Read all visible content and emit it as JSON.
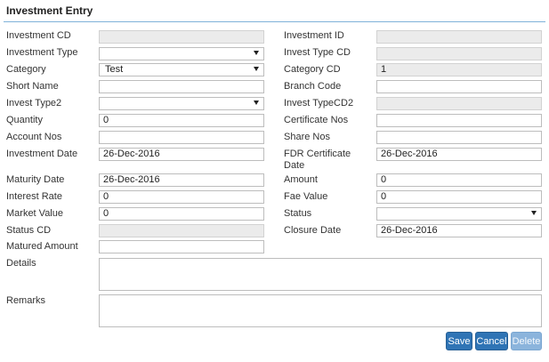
{
  "page_title": "Investment Entry",
  "left": {
    "investment_cd": {
      "label": "Investment CD",
      "value": ""
    },
    "investment_type": {
      "label": "Investment Type",
      "value": ""
    },
    "category": {
      "label": "Category",
      "value": "Test"
    },
    "short_name": {
      "label": "Short Name",
      "value": ""
    },
    "invest_type2": {
      "label": "Invest Type2",
      "value": ""
    },
    "quantity": {
      "label": "Quantity",
      "value": "0"
    },
    "account_nos": {
      "label": "Account Nos",
      "value": ""
    },
    "investment_date": {
      "label": "Investment Date",
      "value": "26-Dec-2016"
    },
    "maturity_date": {
      "label": "Maturity Date",
      "value": "26-Dec-2016"
    },
    "interest_rate": {
      "label": "Interest Rate",
      "value": "0"
    },
    "market_value": {
      "label": "Market Value",
      "value": "0"
    },
    "status_cd": {
      "label": "Status CD",
      "value": ""
    },
    "matured_amount": {
      "label": "Matured Amount",
      "value": ""
    }
  },
  "right": {
    "investment_id": {
      "label": "Investment ID",
      "value": ""
    },
    "invest_type_cd": {
      "label": "Invest Type CD",
      "value": ""
    },
    "category_cd": {
      "label": "Category CD",
      "value": "1"
    },
    "branch_code": {
      "label": "Branch Code",
      "value": ""
    },
    "invest_type_cd2": {
      "label": "Invest TypeCD2",
      "value": ""
    },
    "certificate_nos": {
      "label": "Certificate Nos",
      "value": ""
    },
    "share_nos": {
      "label": "Share Nos",
      "value": ""
    },
    "fdr_certificate_date": {
      "label": "FDR Certificate Date",
      "value": "26-Dec-2016"
    },
    "amount": {
      "label": "Amount",
      "value": "0"
    },
    "fae_value": {
      "label": "Fae Value",
      "value": "0"
    },
    "status": {
      "label": "Status",
      "value": ""
    },
    "closure_date": {
      "label": "Closure Date",
      "value": "26-Dec-2016"
    }
  },
  "details": {
    "label": "Details",
    "value": ""
  },
  "remarks": {
    "label": "Remarks",
    "value": ""
  },
  "buttons": {
    "save": "Save",
    "cancel": "Cancel",
    "delete": "Delete"
  },
  "colors": {
    "primary": "#2f74b5",
    "disabled": "#8bb4dc",
    "readonly_bg": "#ebebeb",
    "rule": "#7fb2d9"
  }
}
